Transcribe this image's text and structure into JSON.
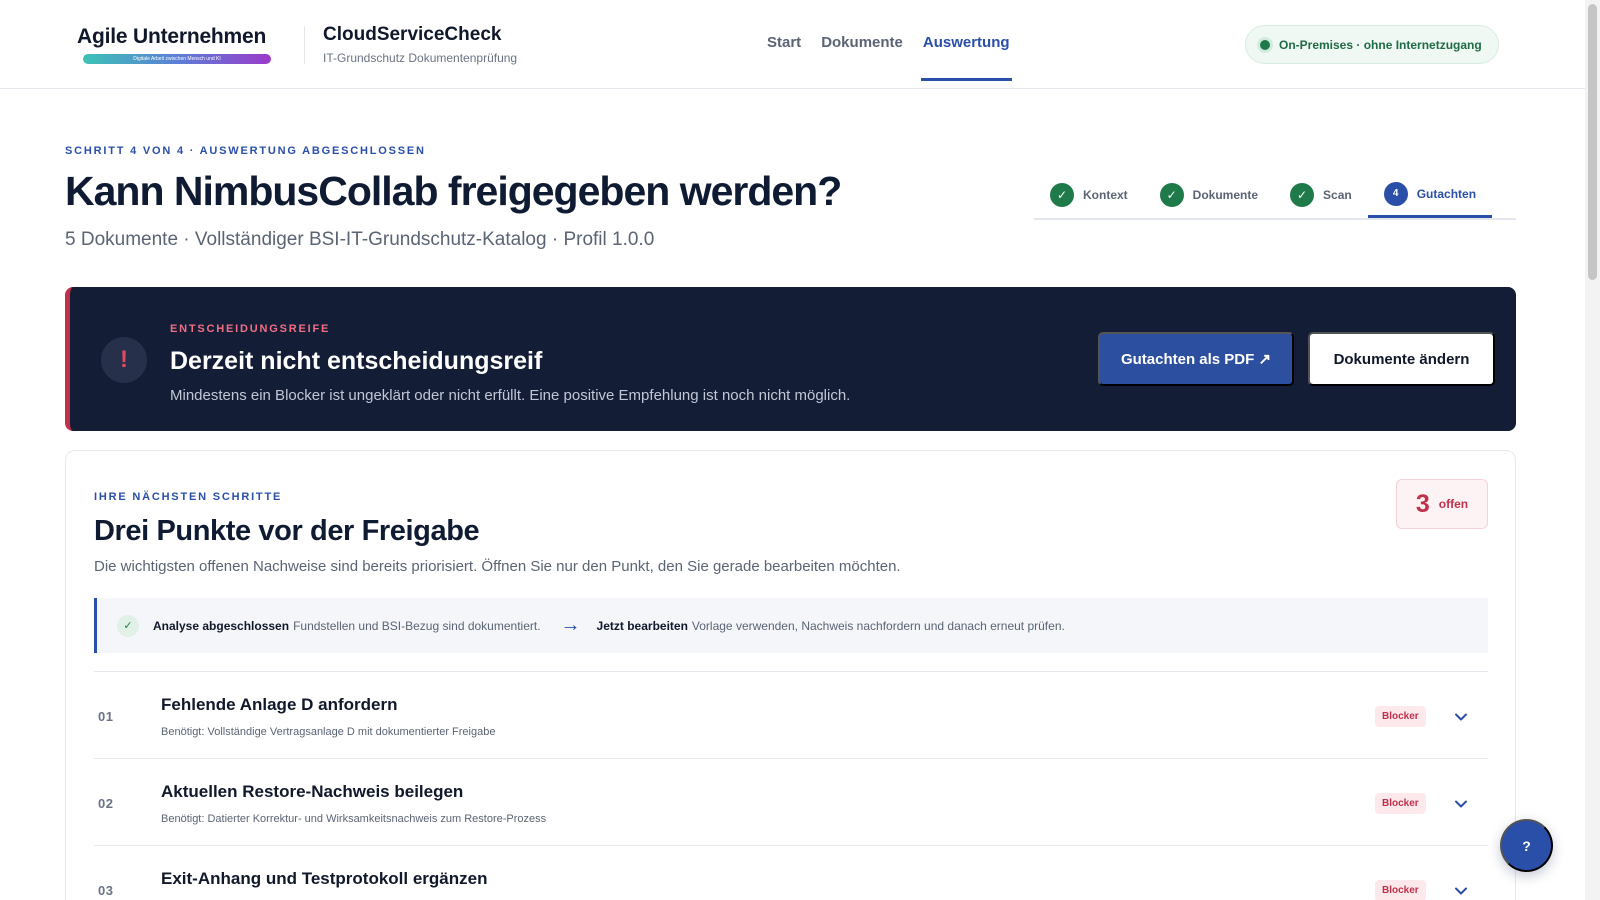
{
  "header": {
    "brand_name": "Agile Unternehmen",
    "brand_tagline": "Digitale Arbeit zwischen Mensch und KI",
    "product_name": "CloudServiceCheck",
    "product_sub": "IT-Grundschutz Dokumentenprüfung",
    "nav": [
      {
        "label": "Start",
        "active": false
      },
      {
        "label": "Dokumente",
        "active": false
      },
      {
        "label": "Auswertung",
        "active": true
      }
    ],
    "env_label": "On-Premises · ohne Internetzugang"
  },
  "hero": {
    "eyebrow": "SCHRITT 4 VON 4 · AUSWERTUNG ABGESCHLOSSEN",
    "title": "Kann NimbusCollab freigegeben werden?",
    "subtitle": "5 Dokumente · Vollständiger BSI-IT-Grundschutz-Katalog · Profil 1.0.0"
  },
  "stepper": [
    {
      "label": "Kontext",
      "badge": "✓",
      "state": "done"
    },
    {
      "label": "Dokumente",
      "badge": "✓",
      "state": "done"
    },
    {
      "label": "Scan",
      "badge": "✓",
      "state": "done"
    },
    {
      "label": "Gutachten",
      "badge": "4",
      "state": "active"
    }
  ],
  "banner": {
    "icon_glyph": "!",
    "eyebrow": "ENTSCHEIDUNGSREIFE",
    "title": "Derzeit nicht entscheidungsreif",
    "text": "Mindestens ein Blocker ist ungeklärt oder nicht erfüllt. Eine positive Empfehlung ist noch nicht möglich.",
    "pdf_button": "Gutachten als PDF ↗",
    "docs_button": "Dokumente ändern"
  },
  "next_steps": {
    "eyebrow": "IHRE NÄCHSTEN SCHRITTE",
    "title": "Drei Punkte vor der Freigabe",
    "text": "Die wichtigsten offenen Nachweise sind bereits priorisiert. Öffnen Sie nur den Punkt, den Sie gerade bearbeiten möchten.",
    "open_count": "3",
    "open_label": "offen",
    "strip": {
      "done_label": "Analyse abgeschlossen",
      "done_text": "Fundstellen und BSI-Bezug sind dokumentiert.",
      "next_label": "Jetzt bearbeiten",
      "next_text": "Vorlage verwenden, Nachweis nachfordern und danach erneut prüfen."
    },
    "items": [
      {
        "num": "01",
        "title": "Fehlende Anlage D anfordern",
        "desc": "Benötigt: Vollständige Vertragsanlage D mit dokumentierter Freigabe",
        "badge": "Blocker"
      },
      {
        "num": "02",
        "title": "Aktuellen Restore-Nachweis beilegen",
        "desc": "Benötigt: Datierter Korrektur- und Wirksamkeitsnachweis zum Restore-Prozess",
        "badge": "Blocker"
      },
      {
        "num": "03",
        "title": "Exit-Anhang und Testprotokoll ergänzen",
        "desc": "",
        "badge": "Blocker"
      }
    ]
  },
  "help_button": "?",
  "icons": {
    "check": "check-icon",
    "alert": "exclamation-icon",
    "arrow": "arrow-right-icon",
    "chevron": "chevron-down-icon"
  },
  "colors": {
    "accent": "#2a4fa8",
    "success": "#1f7a4a",
    "danger": "#c0304a",
    "banner_bg": "#131d36"
  }
}
